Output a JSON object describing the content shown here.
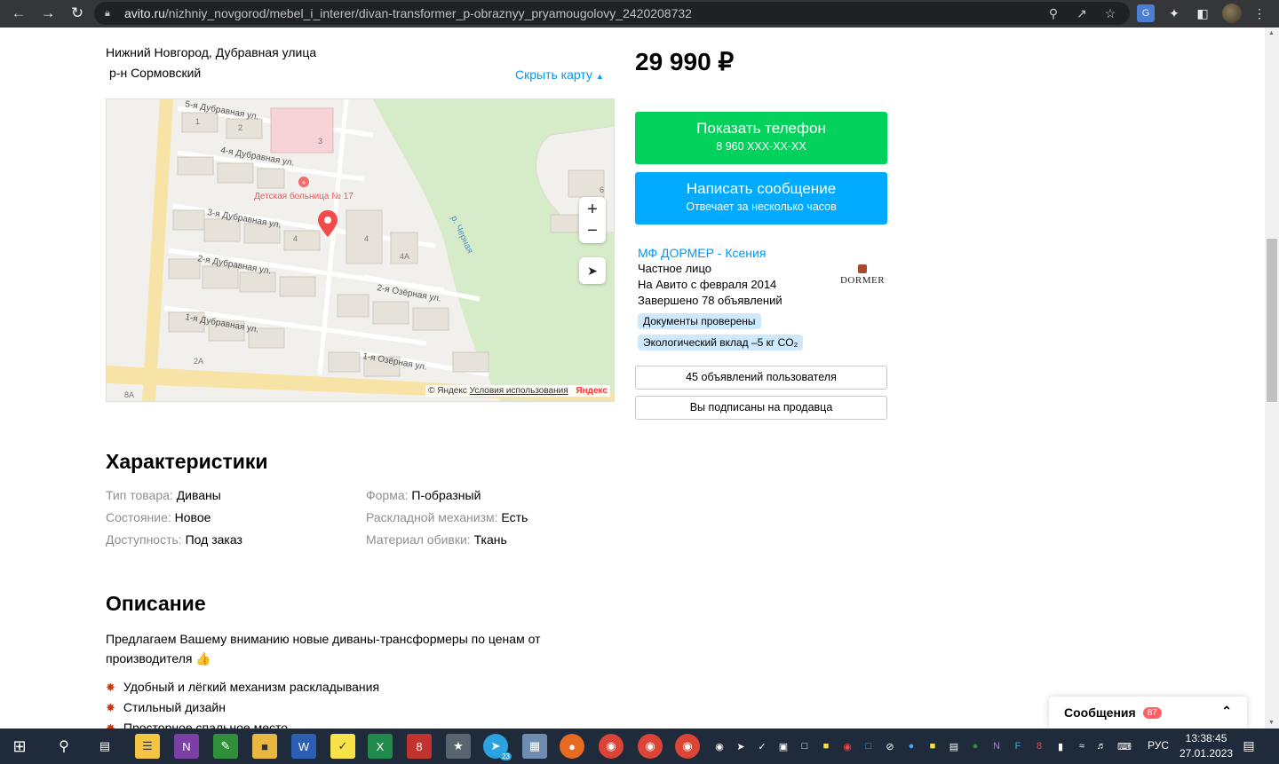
{
  "browser": {
    "url_domain": "avito.ru",
    "url_path": "/nizhniy_novgorod/mebel_i_interer/divan-transformer_p-obraznyy_pryamougolovy_2420208732"
  },
  "location": {
    "address": "Нижний Новгород, Дубравная улица",
    "district": "р-н Сормовский",
    "hide_map_label": "Скрыть карту"
  },
  "map": {
    "streets": [
      "5-я Дубравная ул.",
      "4-я Дубравная ул.",
      "3-я Дубравная ул.",
      "2-я Дубравная ул.",
      "1-я Дубравная ул.",
      "2-я Озёрная ул.",
      "1-я Озёрная ул.",
      "р. Черная"
    ],
    "poi": "Детская больница № 17",
    "house_numbers": [
      "1",
      "2",
      "3",
      "4",
      "4А",
      "2А",
      "6",
      "8А"
    ],
    "zoom_in": "+",
    "zoom_out": "−",
    "copyright": "© Яндекс",
    "terms": "Условия использования",
    "brand": "Яндекс"
  },
  "sidebar": {
    "price": "29 990 ₽",
    "phone_button": {
      "title": "Показать телефон",
      "subtitle": "8 960 XXX-XX-XX"
    },
    "message_button": {
      "title": "Написать сообщение",
      "subtitle": "Отвечает за несколько часов"
    },
    "seller": {
      "name": "МФ ДОРМЕР - Ксения",
      "type": "Частное лицо",
      "since": "На Авито с февраля 2014",
      "completed": "Завершено 78 объявлений",
      "badge_docs": "Документы проверены",
      "badge_eco": "Экологический вклад –5 кг CO₂",
      "logo_text": "DORMER"
    },
    "listings_button": "45 объявлений пользователя",
    "subscribed_button": "Вы подписаны на продавца"
  },
  "characteristics": {
    "title": "Характеристики",
    "items": [
      {
        "key": "Тип товара:",
        "value": "Диваны"
      },
      {
        "key": "Состояние:",
        "value": "Новое"
      },
      {
        "key": "Доступность:",
        "value": "Под заказ"
      },
      {
        "key": "Форма:",
        "value": "П-образный"
      },
      {
        "key": "Раскладной механизм:",
        "value": "Есть"
      },
      {
        "key": "Материал обивки:",
        "value": "Ткань"
      }
    ]
  },
  "description": {
    "title": "Описание",
    "intro_line1": "Предлагаем Вашему вниманию новые диваны-трансформеры по ценам от",
    "intro_line2": "производителя 👍",
    "bullets": [
      "Удобный и лёгкий механизм раскладывания",
      "Стильный дизайн",
      "Просторное спальное место"
    ]
  },
  "messages_widget": {
    "label": "Сообщения",
    "count": "87"
  },
  "taskbar": {
    "telegram_badge": "23",
    "lang": "РУС",
    "time": "13:38:45",
    "date": "27.01.2023"
  },
  "colors": {
    "green": "#02d15c",
    "blue": "#00aaff",
    "link": "#0099f7",
    "taskbar": "#1f2b3a"
  }
}
